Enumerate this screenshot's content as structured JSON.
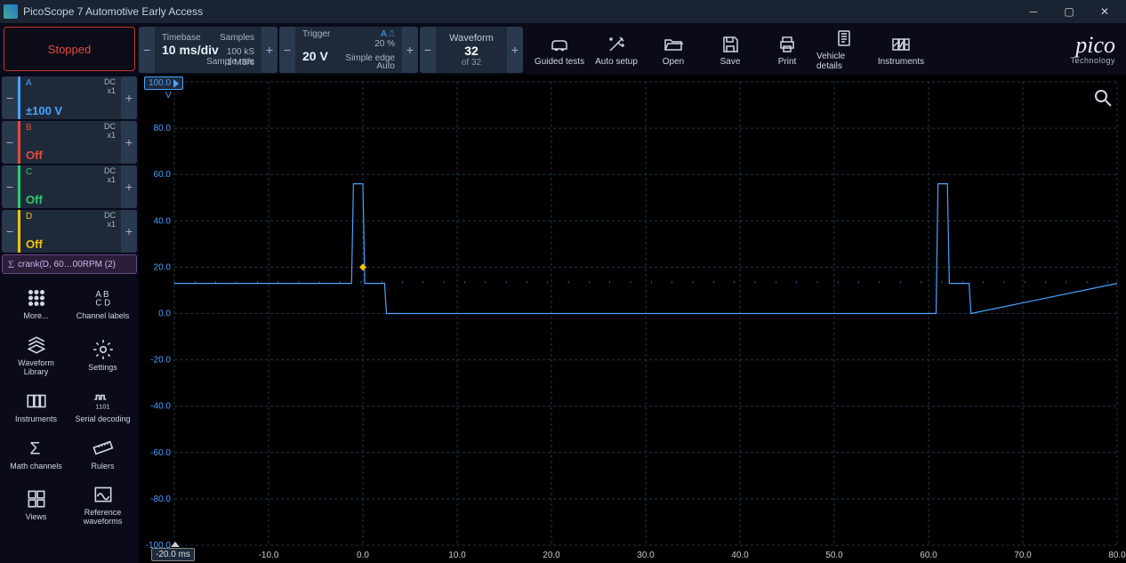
{
  "window": {
    "title": "PicoScope 7 Automotive Early Access"
  },
  "status": {
    "label": "Stopped"
  },
  "timebase": {
    "title": "Timebase",
    "value": "10 ms/div",
    "samples_label": "Samples",
    "samples": "100 kS",
    "rate_label": "Sample rate",
    "rate": "1 MS/s"
  },
  "trigger": {
    "title": "Trigger",
    "value": "20 V",
    "ch": "A",
    "edge_sym": "⎍",
    "percent": "20 %",
    "mode": "Simple edge",
    "auto": "Auto"
  },
  "waveform": {
    "title": "Waveform",
    "value": "32",
    "sub": "of 32"
  },
  "tools": {
    "guided": "Guided tests",
    "autosetup": "Auto setup",
    "open": "Open",
    "save": "Save",
    "print": "Print",
    "vehicle": "Vehicle details",
    "instruments": "Instruments"
  },
  "logo": {
    "brand": "pico",
    "sub": "Technology"
  },
  "channels": {
    "A": {
      "id": "A",
      "dc": "DC",
      "x": "x1",
      "value": "±100 V"
    },
    "B": {
      "id": "B",
      "dc": "DC",
      "x": "x1",
      "value": "Off"
    },
    "C": {
      "id": "C",
      "dc": "DC",
      "x": "x1",
      "value": "Off"
    },
    "D": {
      "id": "D",
      "dc": "DC",
      "x": "x1",
      "value": "Off"
    }
  },
  "math": {
    "label": "crank(D, 60…00RPM (2)"
  },
  "side": {
    "more": "More...",
    "chlabels": "Channel labels",
    "wflib": "Waveform Library",
    "settings": "Settings",
    "instruments": "Instruments",
    "serial": "Serial decoding",
    "mathch": "Math channels",
    "rulers": "Rulers",
    "views": "Views",
    "refwf": "Reference waveforms"
  },
  "axis": {
    "ylabel": "100.0",
    "yunit": "V",
    "yticks": [
      "80.0",
      "60.0",
      "40.0",
      "20.0",
      "0.0",
      "-20.0",
      "-40.0",
      "-60.0",
      "-80.0",
      "-100.0"
    ],
    "xlabel": "-20.0",
    "xunit": "ms",
    "xticks": [
      "-10.0",
      "0.0",
      "10.0",
      "20.0",
      "30.0",
      "40.0",
      "50.0",
      "60.0",
      "70.0",
      "80.0"
    ]
  },
  "chart_data": {
    "type": "line",
    "title": "",
    "xlabel": "ms",
    "ylabel": "V",
    "xlim": [
      -20,
      80
    ],
    "ylim": [
      -100,
      100
    ],
    "series": [
      {
        "name": "A",
        "color": "#4aa3ff",
        "x": [
          -20,
          -1.2,
          -1.0,
          0.0,
          0.2,
          2.3,
          2.5,
          60.8,
          61.0,
          62.0,
          62.2,
          64.3,
          64.5,
          80.0
        ],
        "y": [
          13,
          13,
          56,
          56,
          13,
          13,
          0,
          0,
          56,
          56,
          13,
          13,
          0,
          13
        ]
      }
    ],
    "trigger_marker": {
      "x": 0,
      "y": 20
    }
  }
}
